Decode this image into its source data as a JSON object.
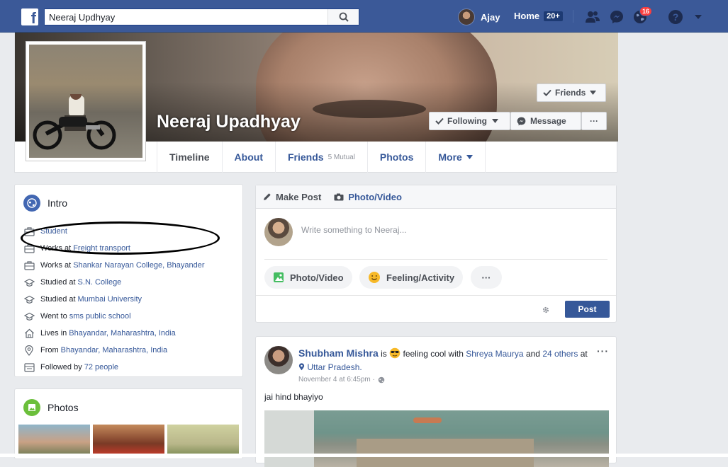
{
  "topbar": {
    "search_value": "Neeraj Updhyay",
    "user_name": "Ajay",
    "home_label": "Home",
    "home_count": "20+",
    "notifications_count": "16",
    "brand_color": "#3b5998"
  },
  "profile": {
    "name": "Neeraj Upadhyay",
    "friends_button": "Friends",
    "following_button": "Following",
    "message_button": "Message",
    "more_button": "···"
  },
  "tabs": [
    {
      "label": "Timeline"
    },
    {
      "label": "About"
    },
    {
      "label": "Friends",
      "sub": "5 Mutual"
    },
    {
      "label": "Photos"
    },
    {
      "label": "More"
    }
  ],
  "intro": {
    "title": "Intro",
    "items": [
      {
        "icon": "briefcase-icon",
        "text": "",
        "link": "Student"
      },
      {
        "icon": "briefcase-icon",
        "text": "Works at",
        "link": "Freight transport"
      },
      {
        "icon": "briefcase-icon",
        "text": "Works at",
        "link": "Shankar Narayan College, Bhayander"
      },
      {
        "icon": "graduation-cap-icon",
        "text": "Studied at",
        "link": "S.N. College"
      },
      {
        "icon": "graduation-cap-icon",
        "text": "Studied at",
        "link": "Mumbai University"
      },
      {
        "icon": "graduation-cap-icon",
        "text": "Went to",
        "link": "sms public school"
      },
      {
        "icon": "home-icon",
        "text": "Lives in",
        "link": "Bhayandar, Maharashtra, India"
      },
      {
        "icon": "location-pin-icon",
        "text": "From",
        "link": "Bhayandar, Maharashtra, India"
      },
      {
        "icon": "followers-icon",
        "text": "Followed by",
        "link": "72 people"
      }
    ]
  },
  "photos": {
    "title": "Photos"
  },
  "composer": {
    "make_post": "Make Post",
    "photo_video_tab": "Photo/Video",
    "placeholder": "Write something to Neeraj...",
    "photo_video_pill": "Photo/Video",
    "feeling_pill": "Feeling/Activity",
    "more_pill": "···",
    "post_button": "Post"
  },
  "feed_post": {
    "author": "Shubham Mishra",
    "is": "is",
    "feeling": "feeling cool with",
    "with_name": "Shreya Maurya",
    "and": "and",
    "others": "24 others",
    "at": "at",
    "place": "Uttar Pradesh.",
    "time": "November 4 at 6:45pm ·",
    "text": "jai hind bhayiyo",
    "more": "···"
  }
}
